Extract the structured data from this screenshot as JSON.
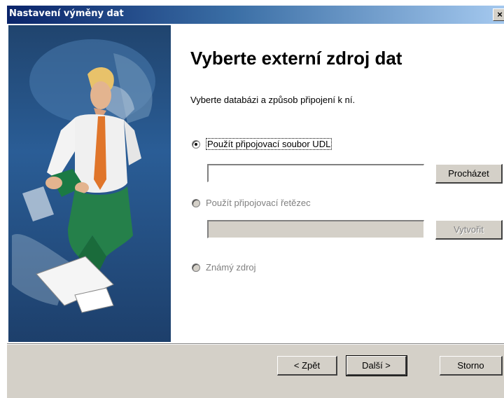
{
  "window": {
    "title": "Nastavení výměny dat",
    "close_glyph": "×"
  },
  "sidebar": {
    "illustration": "man-reading-book-illustration"
  },
  "main": {
    "heading": "Vyberte externí zdroj dat",
    "instruction": "Vyberte databázi a způsob připojení k ní.",
    "options": [
      {
        "label": "Použít připojovací soubor UDL",
        "selected": true,
        "enabled": true,
        "input_value": "",
        "button": "Procházet"
      },
      {
        "label": "Použít připojovací řetězec",
        "selected": false,
        "enabled": false,
        "input_value": "",
        "button": "Vytvořit"
      },
      {
        "label": "Známý zdroj",
        "selected": false,
        "enabled": false
      }
    ]
  },
  "footer": {
    "back": "< Zpět",
    "next": "Další >",
    "cancel": "Storno"
  },
  "colors": {
    "title_start": "#0a246a",
    "title_end": "#a6caf0",
    "face": "#d4d0c8",
    "sidebar": "#2a5d96"
  }
}
